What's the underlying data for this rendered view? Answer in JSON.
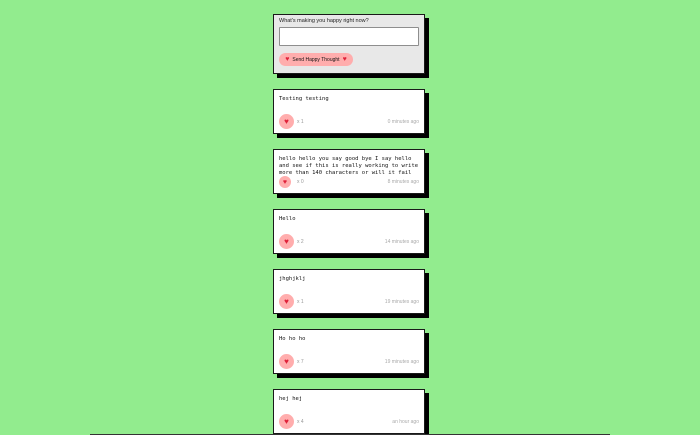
{
  "form": {
    "prompt": "What's making you happy right now?",
    "input_value": "",
    "send_label": "Send Happy Thought",
    "heart": "♥"
  },
  "thoughts": [
    {
      "message": "Testing testing",
      "likes": "x 1",
      "time": "0 minutes ago"
    },
    {
      "message": "hello hello you say good bye I say hello and see if this is really working to write more than 140 characters or will it fail",
      "likes": "x 0",
      "time": "8 minutes ago"
    },
    {
      "message": "Hello",
      "likes": "x 2",
      "time": "14 minutes ago"
    },
    {
      "message": "jhghjklj",
      "likes": "x 1",
      "time": "19 minutes ago"
    },
    {
      "message": "Ho ho ho",
      "likes": "x 7",
      "time": "19 minutes ago"
    },
    {
      "message": "hej hej",
      "likes": "x 4",
      "time": "an hour ago"
    }
  ],
  "colors": {
    "background": "#92ec8e",
    "heart": "#e0223a",
    "like_button": "#ffadad",
    "form_card": "#e8e8e8"
  },
  "icons": {
    "heart": "heart-icon"
  }
}
